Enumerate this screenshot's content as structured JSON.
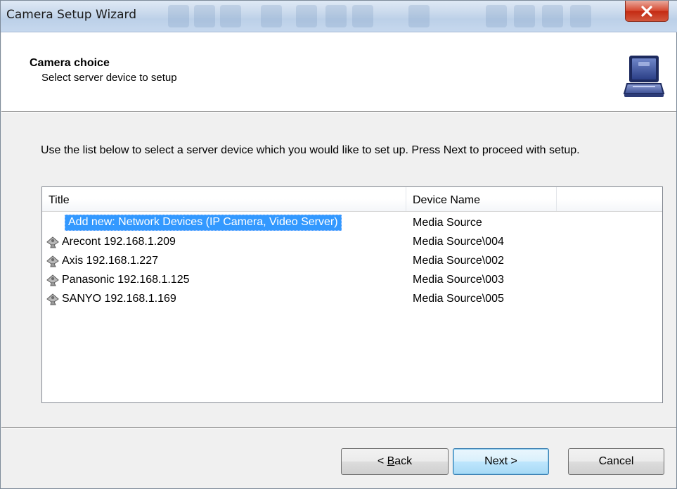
{
  "window": {
    "title": "Camera Setup Wizard",
    "close_icon": "close-x-icon",
    "close_color": "#c42b13"
  },
  "header": {
    "title": "Camera choice",
    "subtitle": "Select server device to setup",
    "icon": "laptop-icon"
  },
  "instruction": "Use the list below to select a server device which you would like to set up. Press Next to proceed with setup.",
  "list": {
    "columns": [
      "Title",
      "Device Name"
    ],
    "rows": [
      {
        "title": "Add new: Network Devices (IP Camera, Video Server)",
        "device": "Media Source",
        "icon": "none",
        "selected": true
      },
      {
        "title": "Arecont 192.168.1.209",
        "device": "Media Source\\004",
        "icon": "camera-icon",
        "selected": false
      },
      {
        "title": "Axis 192.168.1.227",
        "device": "Media Source\\002",
        "icon": "camera-icon",
        "selected": false
      },
      {
        "title": "Panasonic 192.168.1.125",
        "device": "Media Source\\003",
        "icon": "camera-icon",
        "selected": false
      },
      {
        "title": "SANYO 192.168.1.169",
        "device": "Media Source\\005",
        "icon": "camera-icon",
        "selected": false
      }
    ],
    "selection_color": "#3399ff"
  },
  "buttons": {
    "back_prefix": "< ",
    "back_mnemonic": "B",
    "back_rest": "ack",
    "next": "Next >",
    "cancel": "Cancel"
  }
}
